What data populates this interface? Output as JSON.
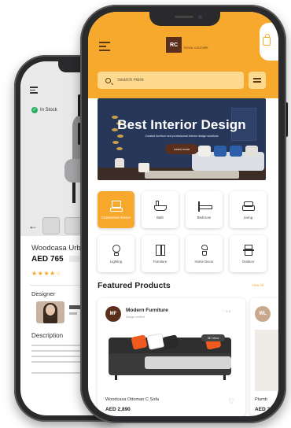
{
  "colors": {
    "accent": "#f7a92e",
    "brand": "#5a2f1b",
    "banner": "#27375a"
  },
  "back_screen": {
    "stock_label": "In Stock",
    "product_title": "Woodcasa Urb",
    "price": "AED 765",
    "rating_stars": "★★★★☆",
    "designer_label": "Designer",
    "description_label": "Description"
  },
  "header": {
    "logo_initials": "RC",
    "logo_name": "ROYAL COUTURE"
  },
  "search": {
    "placeholder": "Search Here"
  },
  "banner": {
    "title": "Best Interior Design",
    "subtitle": "Curated furniture and professional interior design solutions",
    "button": "Learn more"
  },
  "categories": [
    {
      "label": "Customized Interior",
      "icon": "custom-interior-icon",
      "active": true
    },
    {
      "label": "Bath",
      "icon": "bathtub-icon",
      "active": false
    },
    {
      "label": "Bedroom",
      "icon": "bed-icon",
      "active": false
    },
    {
      "label": "Living",
      "icon": "sofa-icon",
      "active": false
    },
    {
      "label": "Lighting",
      "icon": "bulb-icon",
      "active": false
    },
    {
      "label": "Furniture",
      "icon": "cabinet-icon",
      "active": false
    },
    {
      "label": "Home Decor",
      "icon": "plant-icon",
      "active": false
    },
    {
      "label": "Outdoor",
      "icon": "chair-icon",
      "active": false
    }
  ],
  "featured": {
    "title": "Featured Products",
    "view_all": "View All",
    "cards": [
      {
        "avatar": "MF",
        "brand": "Modern Furniture",
        "brand_sub": "Design verified",
        "likes": "♡ 1.4",
        "badge": "3D View",
        "name": "Woodcasa Ottoman C Sofa",
        "price": "AED 2,890"
      },
      {
        "avatar": "WL",
        "name": "Plumb",
        "price": "AED 2"
      }
    ]
  }
}
